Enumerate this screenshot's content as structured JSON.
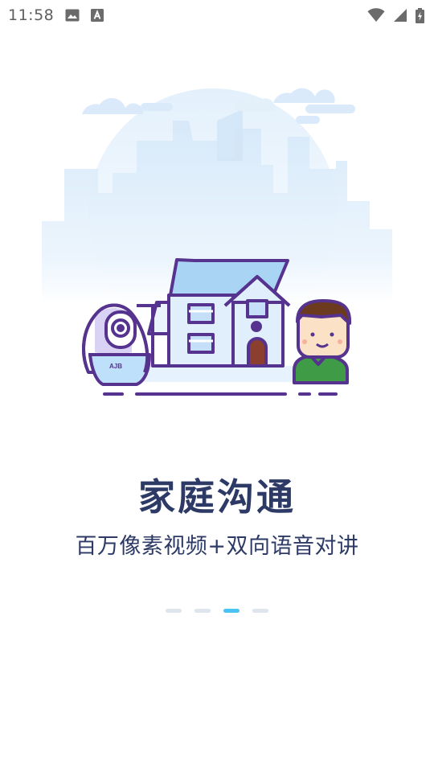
{
  "status_bar": {
    "time": "11:58",
    "icons_left": [
      "image-icon",
      "text-a-icon"
    ],
    "icons_right": [
      "wifi-icon",
      "signal-icon",
      "battery-charging-icon"
    ]
  },
  "onboarding": {
    "title": "家庭沟通",
    "subtitle": "百万像素视频+双向语音对讲",
    "camera_brand": "AJB",
    "page_indicator": {
      "total": 4,
      "active_index": 2
    }
  },
  "colors": {
    "title": "#2d3a66",
    "outline": "#55338f",
    "indicator_active": "#4cc3f5",
    "indicator_inactive": "#dfe5ec"
  }
}
